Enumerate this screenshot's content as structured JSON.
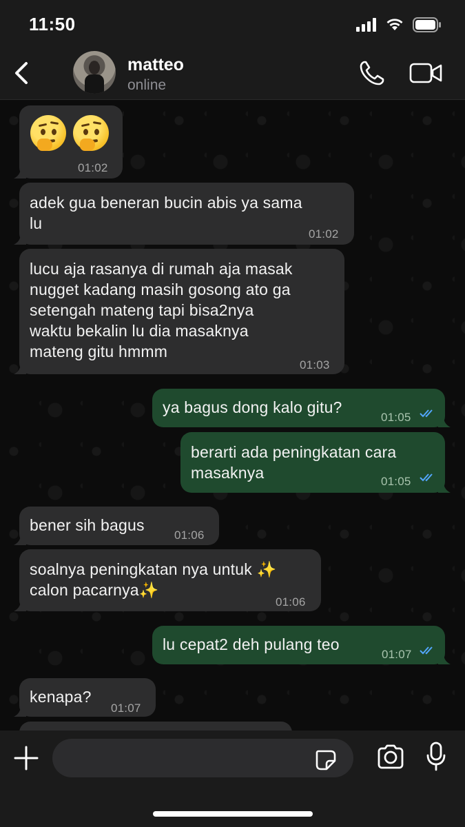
{
  "status_bar": {
    "time": "11:50",
    "icons": [
      "signal-icon",
      "wifi-icon",
      "battery-icon"
    ]
  },
  "header": {
    "back_icon": "chevron-left-icon",
    "contact_name": "matteo",
    "contact_status": "online",
    "call_icon": "phone-icon",
    "video_icon": "video-camera-icon"
  },
  "messages": [
    {
      "direction": "in",
      "type": "emoji",
      "emoji": "🤔🤔",
      "time": "01:02"
    },
    {
      "direction": "in",
      "text": "adek gua beneran bucin abis ya sama\nlu",
      "time": "01:02"
    },
    {
      "direction": "in",
      "text": "lucu aja rasanya di rumah aja masak\nnugget kadang masih gosong ato ga\nsetengah mateng tapi bisa2nya\nwaktu bekalin lu dia masaknya\nmateng gitu hmmm",
      "time": "01:03"
    },
    {
      "direction": "out",
      "text": "ya bagus dong kalo gitu?",
      "time": "01:05",
      "status": "read"
    },
    {
      "direction": "out",
      "text": "berarti ada peningkatan cara\nmasaknya",
      "time": "01:05",
      "status": "read"
    },
    {
      "direction": "in",
      "text": "bener sih bagus",
      "time": "01:06"
    },
    {
      "direction": "in",
      "text": "soalnya peningkatan nya untuk ✨\ncalon pacarnya✨",
      "time": "01:06"
    },
    {
      "direction": "out",
      "text": "lu cepat2 deh pulang teo",
      "time": "01:07",
      "status": "read"
    },
    {
      "direction": "in",
      "text": "kenapa?",
      "time": "01:07"
    }
  ],
  "composer": {
    "plus_icon": "plus-icon",
    "input_value": "",
    "sticker_icon": "sticker-icon",
    "camera_icon": "camera-icon",
    "mic_icon": "microphone-icon"
  },
  "colors": {
    "incoming_bubble": "#2d2d2e",
    "outgoing_bubble": "#1f4a2e",
    "read_ticks": "#53a6fd",
    "bar_background": "#1b1b1b"
  }
}
